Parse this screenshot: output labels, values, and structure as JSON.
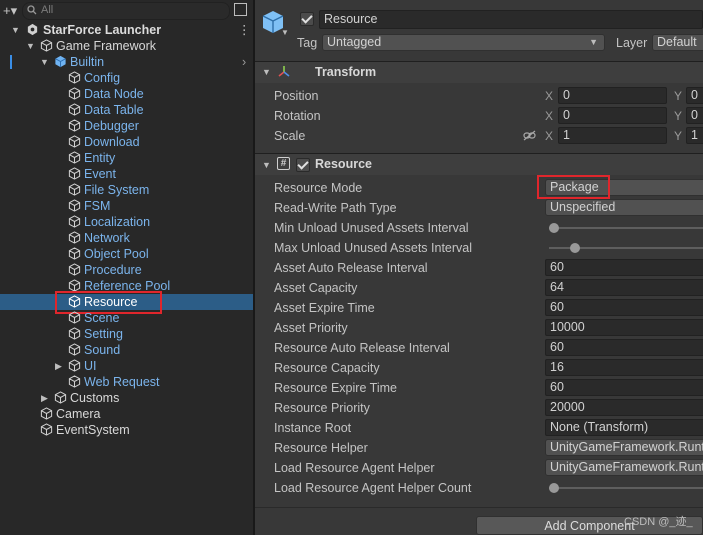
{
  "hierarchy": {
    "search_placeholder": "All",
    "root": "StarForce Launcher",
    "items": [
      {
        "label": "Game Framework"
      },
      {
        "label": "Builtin"
      },
      {
        "label": "Config"
      },
      {
        "label": "Data Node"
      },
      {
        "label": "Data Table"
      },
      {
        "label": "Debugger"
      },
      {
        "label": "Download"
      },
      {
        "label": "Entity"
      },
      {
        "label": "Event"
      },
      {
        "label": "File System"
      },
      {
        "label": "FSM"
      },
      {
        "label": "Localization"
      },
      {
        "label": "Network"
      },
      {
        "label": "Object Pool"
      },
      {
        "label": "Procedure"
      },
      {
        "label": "Reference Pool"
      },
      {
        "label": "Resource"
      },
      {
        "label": "Scene"
      },
      {
        "label": "Setting"
      },
      {
        "label": "Sound"
      },
      {
        "label": "UI"
      },
      {
        "label": "Web Request"
      },
      {
        "label": "Customs"
      },
      {
        "label": "Camera"
      },
      {
        "label": "EventSystem"
      }
    ]
  },
  "inspector": {
    "object_name": "Resource",
    "tag_label": "Tag",
    "tag_value": "Untagged",
    "layer_label": "Layer",
    "layer_value": "Default",
    "transform": {
      "title": "Transform",
      "position_label": "Position",
      "rotation_label": "Rotation",
      "scale_label": "Scale",
      "x": "X",
      "y": "Y",
      "position_x": "0",
      "position_y": "0",
      "rotation_x": "0",
      "rotation_y": "0",
      "scale_x": "1",
      "scale_y": "1"
    },
    "resource": {
      "title": "Resource",
      "props": [
        {
          "label": "Resource Mode",
          "value": "Package"
        },
        {
          "label": "Read-Write Path Type",
          "value": "Unspecified"
        },
        {
          "label": "Min Unload Unused Assets Interval",
          "value": ""
        },
        {
          "label": "Max Unload Unused Assets Interval",
          "value": ""
        },
        {
          "label": "Asset Auto Release Interval",
          "value": "60"
        },
        {
          "label": "Asset Capacity",
          "value": "64"
        },
        {
          "label": "Asset Expire Time",
          "value": "60"
        },
        {
          "label": "Asset Priority",
          "value": "10000"
        },
        {
          "label": "Resource Auto Release Interval",
          "value": "60"
        },
        {
          "label": "Resource Capacity",
          "value": "16"
        },
        {
          "label": "Resource Expire Time",
          "value": "60"
        },
        {
          "label": "Resource Priority",
          "value": "20000"
        },
        {
          "label": "Instance Root",
          "value": "None (Transform)"
        },
        {
          "label": "Resource Helper",
          "value": "UnityGameFramework.Runti"
        },
        {
          "label": "Load Resource Agent Helper",
          "value": "UnityGameFramework.Runti"
        },
        {
          "label": "Load Resource Agent Helper Count",
          "value": ""
        }
      ]
    },
    "add_component": "Add Component",
    "watermark": "CSDN @_迹_"
  },
  "colors": {
    "selection": "#2c5d87",
    "highlight_box": "#e0262c",
    "link_blue": "#7bb4ec"
  }
}
